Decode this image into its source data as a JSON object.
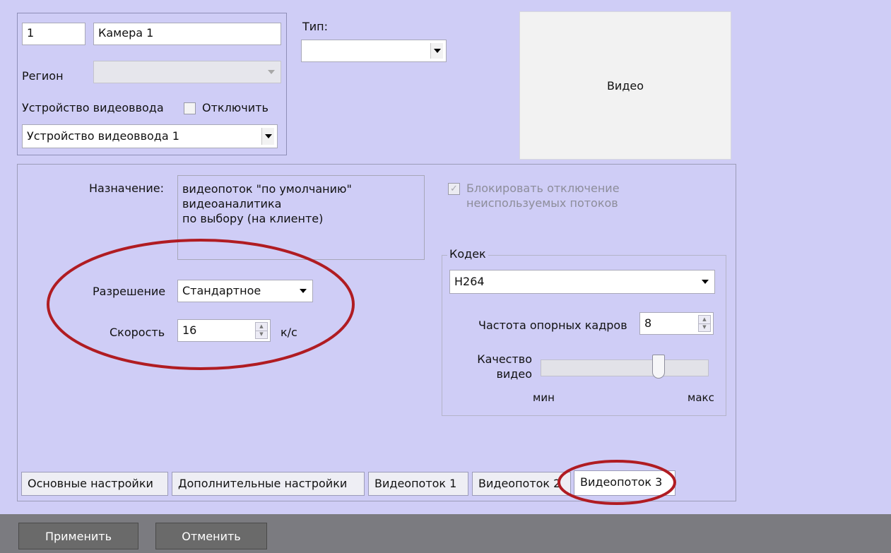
{
  "camera": {
    "number": "1",
    "name": "Камера 1",
    "region_label": "Регион",
    "region_value": "",
    "device_label": "Устройство видеоввода",
    "disable_label": "Отключить",
    "disable_checked": false,
    "device_value": "Устройство видеоввода 1"
  },
  "type": {
    "label": "Тип:",
    "value": ""
  },
  "video": {
    "label": "Видео"
  },
  "stream": {
    "purpose_label": "Назначение:",
    "purpose_lines": [
      "видеопоток \"по умолчанию\"",
      "видеоаналитика",
      "по выбору (на клиенте)"
    ],
    "block_disable_line1": "Блокировать отключение",
    "block_disable_line2": "неиспользуемых потоков",
    "block_disable_checked": true,
    "resolution_label": "Разрешение",
    "resolution_value": "Стандартное",
    "speed_label": "Скорость",
    "speed_value": "16",
    "speed_unit": "к/с",
    "codec": {
      "group_label": "Кодек",
      "value": "H264",
      "keyframe_label": "Частота опорных кадров",
      "keyframe_value": "8",
      "quality_label_line1": "Качество",
      "quality_label_line2": "видео",
      "quality_min": "мин",
      "quality_max": "макс",
      "quality_level": 0.72
    }
  },
  "tabs": [
    "Основные настройки",
    "Дополнительные настройки",
    "Видеопоток 1",
    "Видеопоток 2",
    "Видеопоток 3"
  ],
  "active_tab": "Видеопоток 3",
  "footer": {
    "apply_label": "Применить",
    "cancel_label": "Отменить"
  },
  "colors": {
    "background": "#cfcdf6",
    "annotation_ring": "#b01c22",
    "footer": "#7b7b80"
  }
}
